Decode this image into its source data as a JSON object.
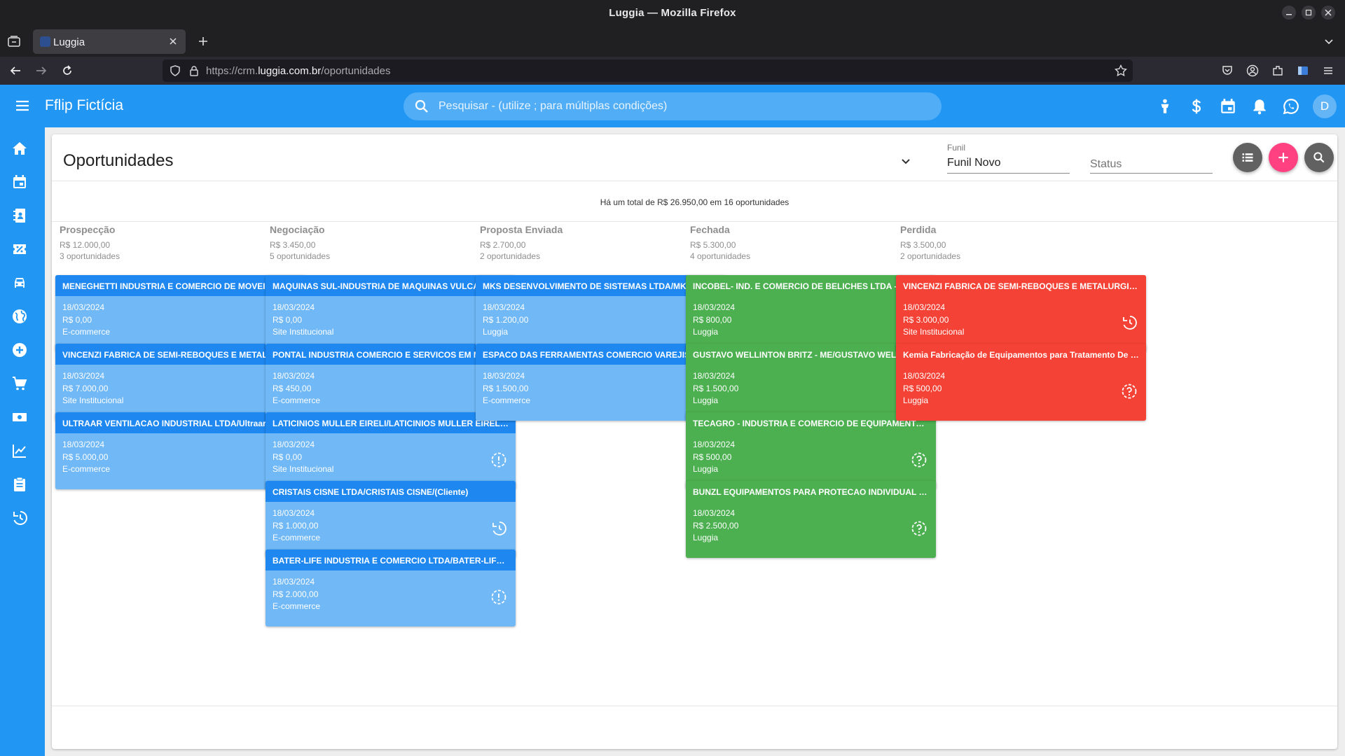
{
  "browser": {
    "window_title": "Luggia — Mozilla Firefox",
    "tab_label": "Luggia",
    "url_prefix": "https://crm.",
    "url_domain": "luggia.com.br",
    "url_path": "/oportunidades"
  },
  "app": {
    "brand": "Fflip Fictícia",
    "search_placeholder": "Pesquisar - (utilize ; para múltiplas condições)",
    "avatar_letter": "D",
    "accent": "#2196f3"
  },
  "page": {
    "title": "Oportunidades",
    "funnel_label": "Funil",
    "funnel_value": "Funil Novo",
    "status_placeholder": "Status",
    "total_text": "Há um total de R$ 26.950,00 em 16 oportunidades"
  },
  "columns": [
    {
      "name": "Prospecção",
      "sum": "R$ 12.000,00",
      "count": "3 oportunidades",
      "color": "blue",
      "cards": [
        {
          "title": "MENEGHETTI INDUSTRIA E COMERCIO DE MOVEIS LTDA - ...",
          "date": "18/03/2024",
          "value": "R$ 0,00",
          "source": "E-commerce",
          "state_icon": "alert-clock-icon"
        },
        {
          "title": "VINCENZI FABRICA DE SEMI-REBOQUES E METALURGICA L...",
          "date": "18/03/2024",
          "value": "R$ 7.000,00",
          "source": "Site Institucional",
          "state_icon": "history-icon"
        },
        {
          "title": "ULTRAAR VENTILACAO INDUSTRIAL LTDA/Ultraar Ventilaç...",
          "date": "18/03/2024",
          "value": "R$ 5.000,00",
          "source": "E-commerce",
          "state_icon": "history-icon"
        }
      ]
    },
    {
      "name": "Negociação",
      "sum": "R$ 3.450,00",
      "count": "5 oportunidades",
      "color": "blue",
      "cards": [
        {
          "title": "MAQUINAS SUL-INDUSTRIA DE MAQUINAS VULCANIZADO...",
          "date": "18/03/2024",
          "value": "R$ 0,00",
          "source": "Site Institucional",
          "state_icon": "history-icon"
        },
        {
          "title": "PONTAL INDUSTRIA COMERCIO E SERVICOS EM MAQUINA...",
          "date": "18/03/2024",
          "value": "R$ 450,00",
          "source": "E-commerce",
          "state_icon": "history-icon"
        },
        {
          "title": "LATICINIOS MULLER EIRELI/LATICINIOS MULLER EIRELI/(...",
          "date": "18/03/2024",
          "value": "R$ 0,00",
          "source": "Site Institucional",
          "state_icon": "alert-clock-icon"
        },
        {
          "title": "CRISTAIS CISNE LTDA/CRISTAIS CISNE/(Cliente)",
          "date": "18/03/2024",
          "value": "R$ 1.000,00",
          "source": "E-commerce",
          "state_icon": "history-icon"
        },
        {
          "title": "BATER-LIFE INDUSTRIA E COMERCIO LTDA/BATER-LIFE/(C...",
          "date": "18/03/2024",
          "value": "R$ 2.000,00",
          "source": "E-commerce",
          "state_icon": "alert-clock-icon"
        }
      ]
    },
    {
      "name": "Proposta Enviada",
      "sum": "R$ 2.700,00",
      "count": "2 oportunidades",
      "color": "blue",
      "cards": [
        {
          "title": "MKS DESENVOLVIMENTO DE SISTEMAS LTDA/MKS SISTE...",
          "date": "18/03/2024",
          "value": "R$ 1.200,00",
          "source": "Luggia",
          "state_icon": "target-clock-icon"
        },
        {
          "title": "ESPACO DAS FERRAMENTAS COMERCIO VAREJISTA E MA...",
          "date": "18/03/2024",
          "value": "R$ 1.500,00",
          "source": "E-commerce",
          "state_icon": "history-icon"
        }
      ]
    },
    {
      "name": "Fechada",
      "sum": "R$ 5.300,00",
      "count": "4 oportunidades",
      "color": "green",
      "cards": [
        {
          "title": "INCOBEL- IND. E COMERCIO DE BELICHES LTDA - EPP/INC...",
          "date": "18/03/2024",
          "value": "R$ 800,00",
          "source": "Luggia",
          "state_icon": "history-icon"
        },
        {
          "title": "GUSTAVO WELLINTON BRITZ - ME/GUSTAVO WELLINTON ...",
          "date": "18/03/2024",
          "value": "R$ 1.500,00",
          "source": "Luggia",
          "state_icon": "history-icon"
        },
        {
          "title": "TECAGRO - INDUSTRIA E COMERCIO DE EQUIPAMENTOS P...",
          "date": "18/03/2024",
          "value": "R$ 500,00",
          "source": "Luggia",
          "state_icon": "help-clock-icon"
        },
        {
          "title": "BUNZL EQUIPAMENTOS PARA PROTECAO INDIVIDUAL LTD...",
          "date": "18/03/2024",
          "value": "R$ 2.500,00",
          "source": "Luggia",
          "state_icon": "help-clock-icon"
        }
      ]
    },
    {
      "name": "Perdida",
      "sum": "R$ 3.500,00",
      "count": "2 oportunidades",
      "color": "red",
      "cards": [
        {
          "title": "VINCENZI FABRICA DE SEMI-REBOQUES E METALURGICA L...",
          "date": "18/03/2024",
          "value": "R$ 3.000,00",
          "source": "Site Institucional",
          "state_icon": "history-icon"
        },
        {
          "title": "Kemia Fabricação de Equipamentos para Tratamento De Efl...",
          "date": "18/03/2024",
          "value": "R$ 500,00",
          "source": "Luggia",
          "state_icon": "help-clock-icon"
        }
      ]
    }
  ],
  "sidebar_icons": [
    "home-icon",
    "calendar-icon",
    "contacts-book-icon",
    "ticket-percent-icon",
    "car-icon",
    "globe-icon",
    "add-circle-icon",
    "cart-icon",
    "cash-icon",
    "chart-line-icon",
    "clipboard-icon",
    "history-icon"
  ],
  "header_icons": [
    "person-icon",
    "dollar-icon",
    "calendar-icon",
    "bell-icon",
    "whatsapp-icon"
  ]
}
